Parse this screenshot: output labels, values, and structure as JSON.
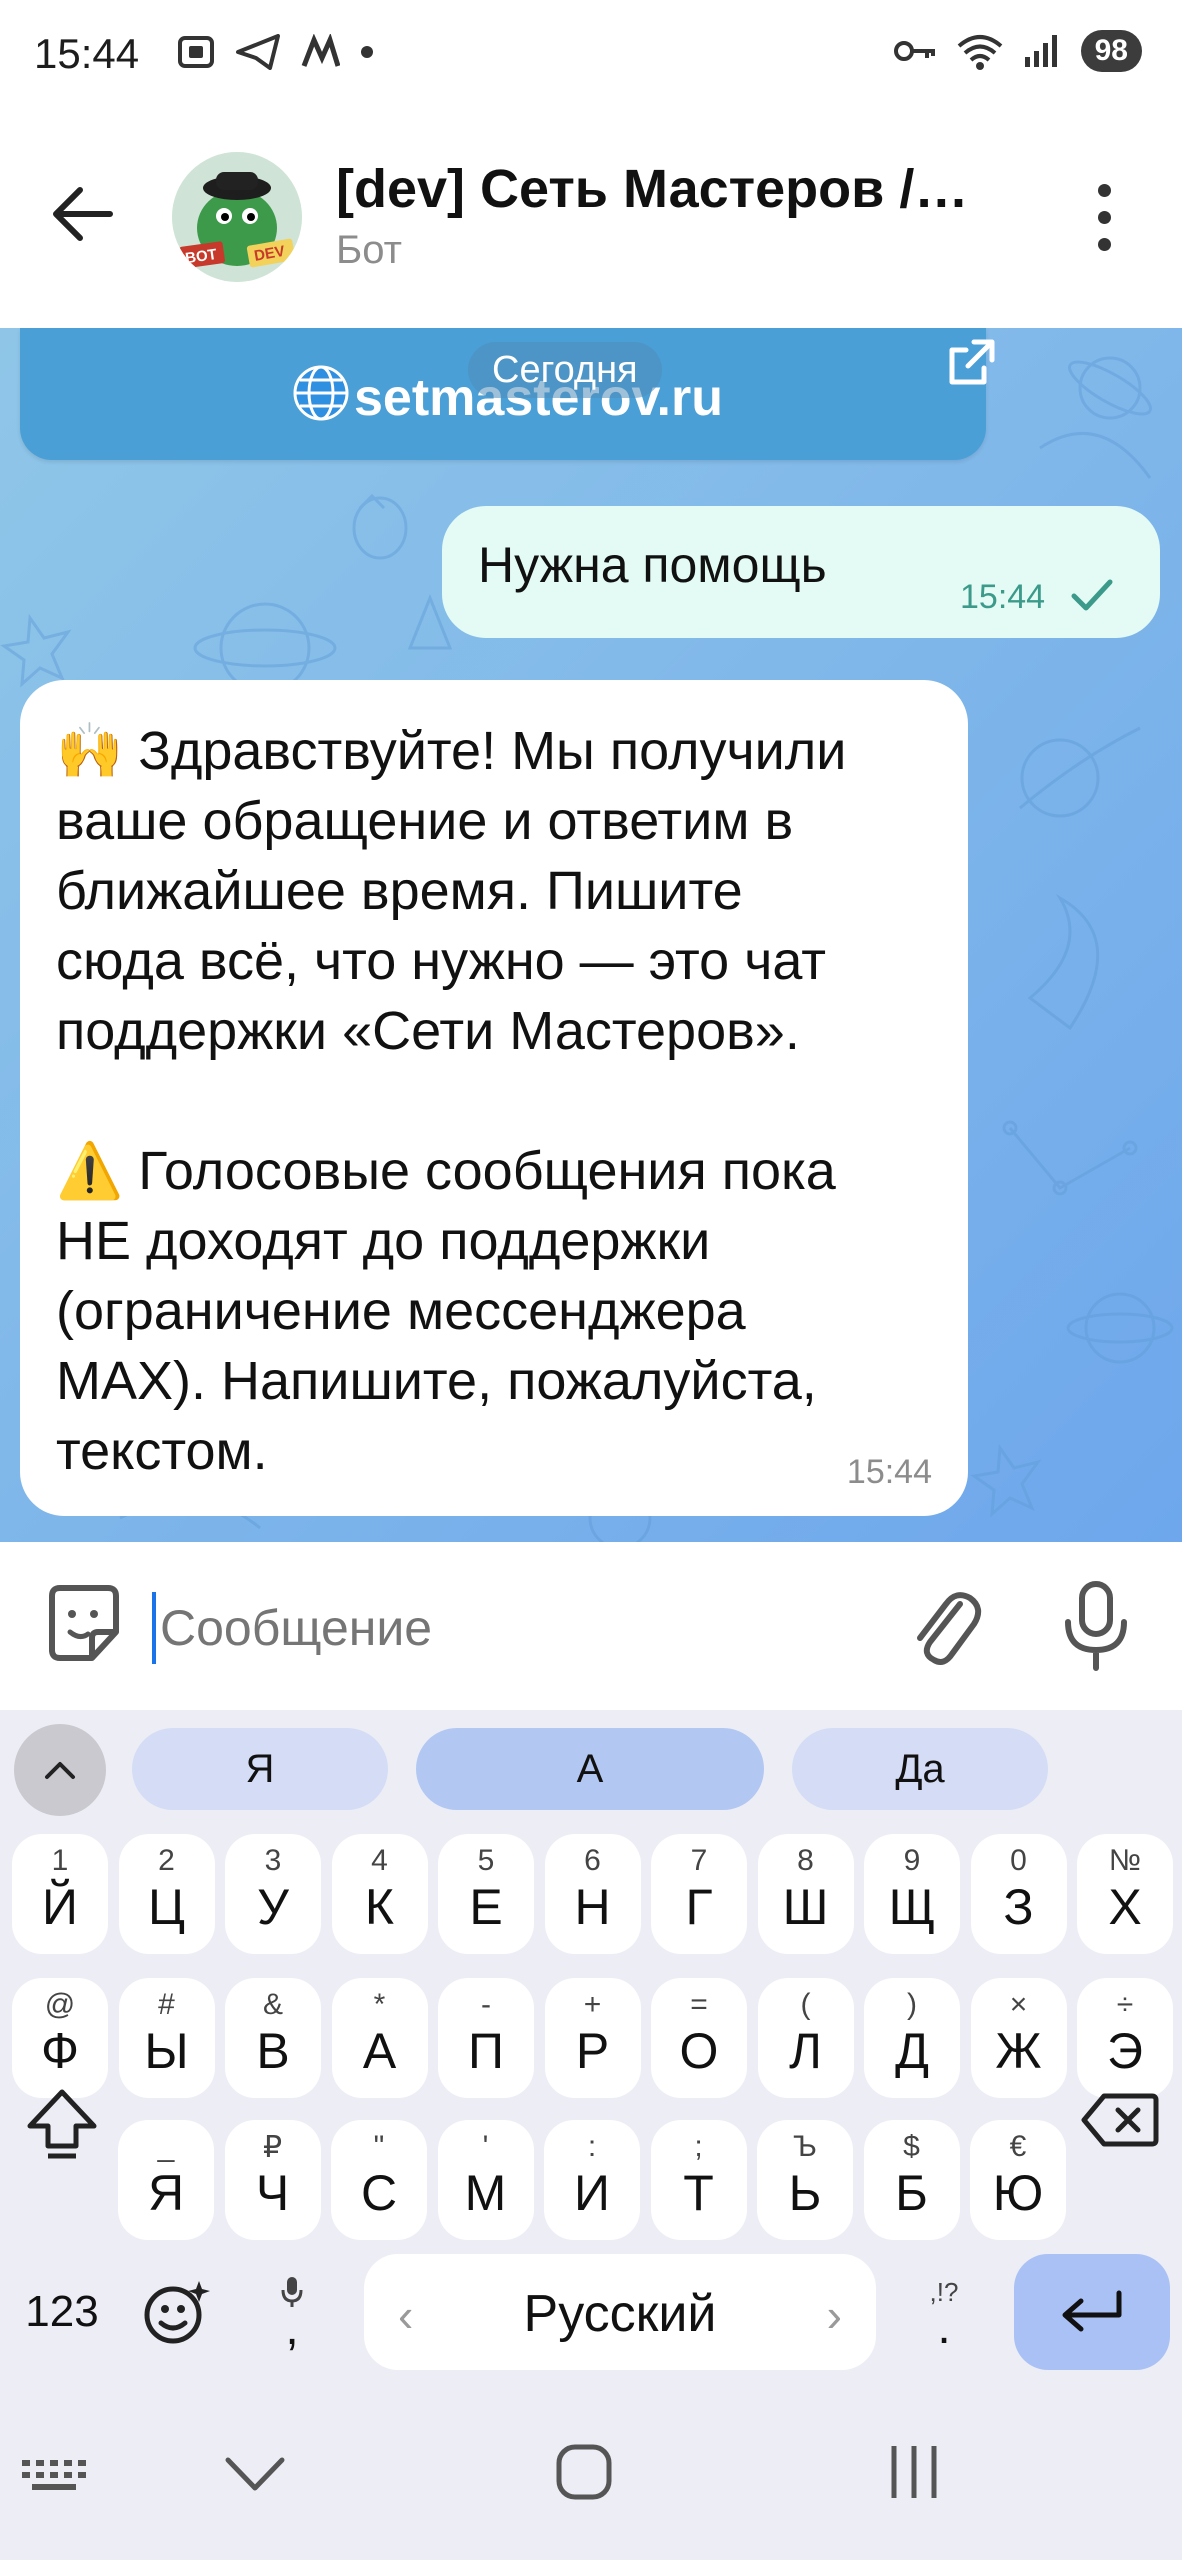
{
  "status_bar": {
    "time": "15:44",
    "battery": "98",
    "signal_label": "6"
  },
  "header": {
    "back_icon": "arrow-left-icon",
    "title": "[dev] Сеть Мастеров /…",
    "subtitle": "Бот",
    "avatar_badges": [
      "BOT",
      "DEV"
    ]
  },
  "chat": {
    "link_card_text": "setmasterov.ru",
    "date_divider": "Сегодня",
    "outgoing": {
      "text": "Нужна помощь",
      "time": "15:44"
    },
    "incoming": {
      "lines_1": [
        "🙌 Здравствуйте! Мы получили",
        "ваше обращение и ответим в",
        "ближайшее время. Пишите",
        "сюда всё, что нужно — это чат",
        "поддержки «Сети Мастеров»."
      ],
      "lines_2": [
        "⚠️ Голосовые сообщения пока",
        "НЕ доходят до поддержки",
        "(ограничение мессенджера",
        "MAX). Напишите, пожалуйста,",
        "текстом."
      ],
      "time": "15:44"
    }
  },
  "input_bar": {
    "placeholder": "Сообщение"
  },
  "keyboard": {
    "suggestions": [
      "Я",
      "А",
      "Да"
    ],
    "row1": [
      {
        "sup": "1",
        "main": "Й"
      },
      {
        "sup": "2",
        "main": "Ц"
      },
      {
        "sup": "3",
        "main": "У"
      },
      {
        "sup": "4",
        "main": "К"
      },
      {
        "sup": "5",
        "main": "Е"
      },
      {
        "sup": "6",
        "main": "Н"
      },
      {
        "sup": "7",
        "main": "Г"
      },
      {
        "sup": "8",
        "main": "Ш"
      },
      {
        "sup": "9",
        "main": "Щ"
      },
      {
        "sup": "0",
        "main": "З"
      },
      {
        "sup": "№",
        "main": "Х"
      }
    ],
    "row2": [
      {
        "sup": "@",
        "main": "Ф"
      },
      {
        "sup": "#",
        "main": "Ы"
      },
      {
        "sup": "&",
        "main": "В"
      },
      {
        "sup": "*",
        "main": "А"
      },
      {
        "sup": "-",
        "main": "П"
      },
      {
        "sup": "+",
        "main": "Р"
      },
      {
        "sup": "=",
        "main": "О"
      },
      {
        "sup": "(",
        "main": "Л"
      },
      {
        "sup": ")",
        "main": "Д"
      },
      {
        "sup": "×",
        "main": "Ж"
      },
      {
        "sup": "÷",
        "main": "Э"
      }
    ],
    "row3": [
      {
        "sup": "_",
        "main": "Я"
      },
      {
        "sup": "₽",
        "main": "Ч"
      },
      {
        "sup": "\"",
        "main": "С"
      },
      {
        "sup": "'",
        "main": "М"
      },
      {
        "sup": ":",
        "main": "И"
      },
      {
        "sup": ";",
        "main": "Т"
      },
      {
        "sup": "Ъ",
        "main": "Ь"
      },
      {
        "sup": "$",
        "main": "Б"
      },
      {
        "sup": "€",
        "main": "Ю"
      }
    ],
    "numbers_key": "123",
    "comma_key": ",",
    "space_label": "Русский",
    "period_sup": ",!?",
    "period_key": "."
  },
  "colors": {
    "chat_bg": "#7fb7ea",
    "outgoing_bubble": "#e3fbf4",
    "link_card": "#4a9fd6",
    "enter_key": "#a9c1f5",
    "suggestion_active": "#b2c7f2"
  }
}
